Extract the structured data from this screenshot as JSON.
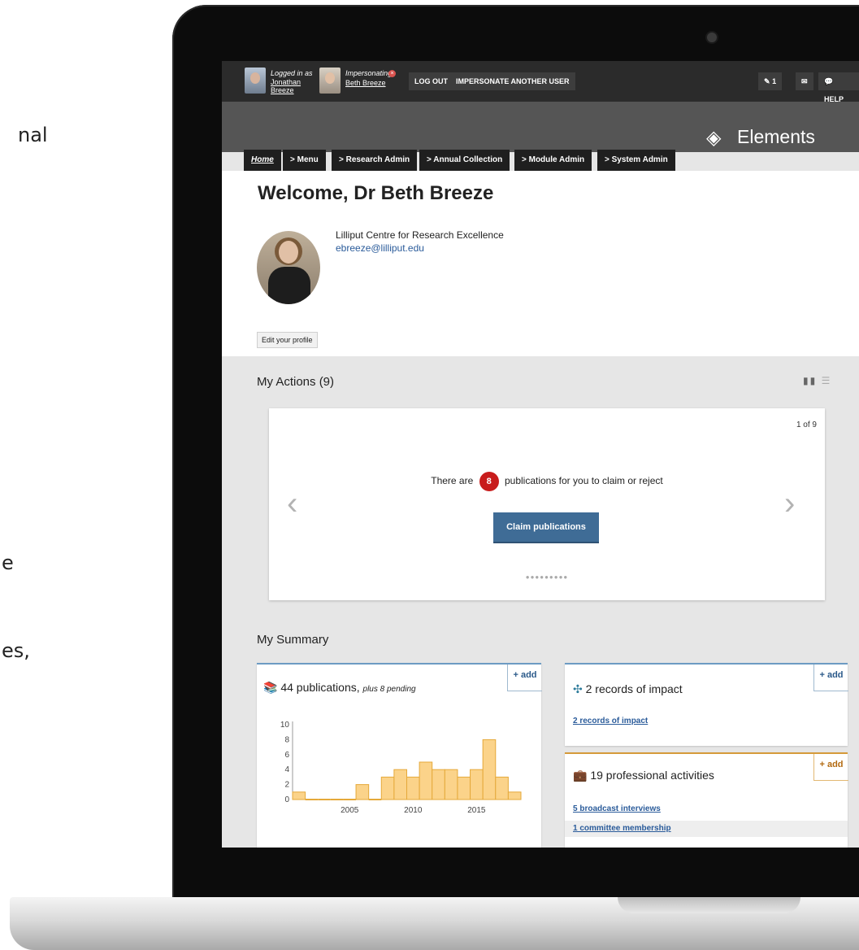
{
  "background_text": [
    "nal",
    "e",
    "es,"
  ],
  "topbar": {
    "logged_in_label": "Logged in as",
    "logged_in_user_line1": "Jonathan",
    "logged_in_user_line2": "Breeze",
    "impersonating_label": "Impersonating",
    "impersonated_user": "Beth Breeze",
    "logout": "LOG OUT",
    "impersonate_another": "IMPERSONATE ANOTHER USER",
    "notifications_count": "1",
    "help": "HELP"
  },
  "brand": {
    "name": "Elements"
  },
  "tabs": [
    {
      "label": "Home"
    },
    {
      "label": "> Menu"
    },
    {
      "label": "> Research Admin"
    },
    {
      "label": "> Annual Collection"
    },
    {
      "label": "> Module Admin"
    },
    {
      "label": "> System Admin"
    }
  ],
  "welcome": {
    "title": "Welcome, Dr Beth Breeze",
    "affiliation": "Lilliput Centre for Research Excellence",
    "email": "ebreeze@lilliput.edu",
    "edit_profile": "Edit your profile"
  },
  "actions": {
    "title": "My Actions (9)",
    "pager": "1 of 9",
    "message_before": "There are",
    "count": "8",
    "message_after": "publications for you to claim or reject",
    "claim_button": "Claim publications",
    "prev_glyph": "‹",
    "next_glyph": "›",
    "dots": "●●●●●●●●●"
  },
  "summary": {
    "title": "My Summary",
    "add_label": "+ add",
    "publications": {
      "title": "44 publications,",
      "sub": "plus 8 pending"
    },
    "impact": {
      "title": "2 records of impact",
      "link": "2 records of impact"
    },
    "activities": {
      "title": "19 professional activities",
      "links": [
        "5 broadcast interviews",
        "1 committee membership"
      ]
    }
  },
  "chart_data": {
    "type": "bar",
    "x": [
      2001,
      2002,
      2003,
      2004,
      2005,
      2006,
      2007,
      2008,
      2009,
      2010,
      2011,
      2012,
      2013,
      2014,
      2015,
      2016,
      2017
    ],
    "values": [
      1,
      0,
      0,
      0,
      0,
      2,
      0,
      3,
      4,
      3,
      5,
      4,
      4,
      3,
      4,
      8,
      3,
      1
    ],
    "x_start": 2001,
    "ylim": [
      0,
      10
    ],
    "yticks": [
      0,
      2,
      4,
      6,
      8,
      10
    ],
    "xticks": [
      2005,
      2010,
      2015
    ],
    "bar_color": "#fbd38a",
    "edge_color": "#e5a93a"
  }
}
